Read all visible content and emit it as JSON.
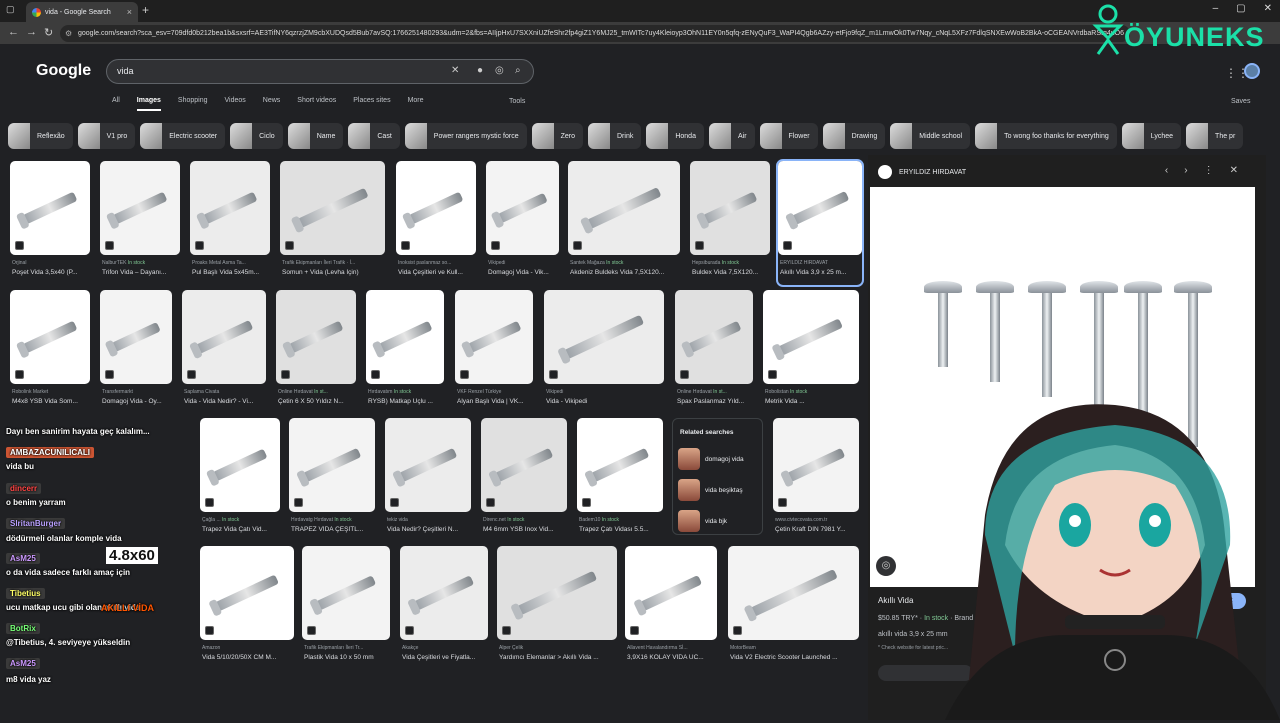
{
  "browser": {
    "tab_title": "vida - Google Search",
    "url": "google.com/search?sca_esv=709dfd0b212bea1b&sxsrf=AE3TifNY6qzrzjZM9cbXUDQsd5Bub7avSQ:1766251480293&udm=2&fbs=AIIjpHxU7SXXniUZfeShr2fp4giZ1Y6MJ25_tmWITc7uy4Kleioyp3OhN11EY0n5qfq-zENyQuF3_WaPI4Qgb6AZzy-etFjo9fqZ_m1LmwOk0Tw7Nqy_cNqL5XFz7FdlqSNXEwWoB2BkA-oCGEANVrdbaRStq4uO6"
  },
  "google": {
    "logo": "Google",
    "query": "vida",
    "filters": [
      "All",
      "Images",
      "Shopping",
      "Videos",
      "News",
      "Short videos",
      "Places sites",
      "More"
    ],
    "active_filter": "Images",
    "tools": "Tools",
    "saves": "Saves"
  },
  "chips": [
    "Reflexão",
    "V1 pro",
    "Electric scooter",
    "Ciclo",
    "Name",
    "Cast",
    "Power rangers mystic force",
    "Zero",
    "Drink",
    "Honda",
    "Air",
    "Flower",
    "Drawing",
    "Middle school",
    "To wong foo thanks for everything",
    "Lychee",
    "The pr"
  ],
  "row1": [
    {
      "src": "Orjinal",
      "stock": "",
      "title": "Poşet Vida 3,5x40 (P..."
    },
    {
      "src": "NalburTEK",
      "stock": "In stock",
      "title": "Trifon Vida – Dayanı..."
    },
    {
      "src": "Proaks Metal Asma Ta...",
      "stock": "",
      "title": "Pul Başlı Vida 5x45m..."
    },
    {
      "src": "Trafik Ekipmanları İleri Trafik · İ...",
      "stock": "",
      "title": "Somun + Vida (Levha İçin)"
    },
    {
      "src": "Inoksist paslanmaz so...",
      "stock": "",
      "title": "Vida Çeşitleri ve Kull..."
    },
    {
      "src": "Vikipedi",
      "stock": "",
      "title": "Domagoj Vida - Vik..."
    },
    {
      "src": "Santek Mağaza",
      "stock": "In stock",
      "title": "Akdeniz Buldeks Vida 7,5X120..."
    },
    {
      "src": "Hepsiburada",
      "stock": "In stock",
      "title": "Buldex Vida 7,5X120..."
    },
    {
      "src": "ERYILDIZ HIRDAVAT",
      "stock": "",
      "title": "Akıllı Vida 3,9 x 25 m..."
    }
  ],
  "row2": [
    {
      "src": "Robolink Market",
      "stock": "",
      "title": "M4x8 YSB Vida Som..."
    },
    {
      "src": "Transfermarkt",
      "stock": "",
      "title": "Domagoj Vida - Oy..."
    },
    {
      "src": "Saplama Civata",
      "stock": "",
      "title": "Vida - Vida Nedir? - Vi..."
    },
    {
      "src": "Online Hırdavat",
      "stock": "In st...",
      "title": "Çetin 6 X 50 Yıldız N..."
    },
    {
      "src": "Hırdavatım",
      "stock": "In stock",
      "title": "RYSB) Matkap Uçlu ..."
    },
    {
      "src": "VKF Renzel Türkiye",
      "stock": "",
      "title": "Alyan Başlı Vida | VK..."
    },
    {
      "src": "Vikipedi",
      "stock": "",
      "title": "Vida - Vikipedi"
    },
    {
      "src": "Online Hırdavat",
      "stock": "In st...",
      "title": "Spax Paslanmaz Yıld..."
    },
    {
      "src": "Robolistan",
      "stock": "In stock",
      "title": "Metrik Vida ..."
    }
  ],
  "row3": [
    {
      "src": "Çağla ...",
      "stock": "In stock",
      "title": "Trapez Vida Çatı Vid..."
    },
    {
      "src": "Hırdavatg Hırdavat",
      "stock": "In stock",
      "title": "TRAPEZ VİDA ÇEŞİTL..."
    },
    {
      "src": "tekiz vida",
      "stock": "",
      "title": "Vida Nedir? Çeşitleri N..."
    },
    {
      "src": "Direnc.net",
      "stock": "In stock",
      "title": "M4 6mm YSB Inox Vid..."
    },
    {
      "src": "Badem10",
      "stock": "In stock",
      "title": "Trapez Çatı Vidası 5.5..."
    },
    {
      "src": "www.civtecovata.com.tr",
      "stock": "",
      "title": "Çetin Kraft DIN 7981 Y..."
    }
  ],
  "row4": [
    {
      "src": "Amazon",
      "stock": "",
      "title": "Vida 5/10/20/50X CM M..."
    },
    {
      "src": "Trafik Ekipmanları İleri Tr...",
      "stock": "",
      "title": "Plastik Vida 10 x 50 mm"
    },
    {
      "src": "Akakçe",
      "stock": "",
      "title": "Vida Çeşitleri ve Fiyatla..."
    },
    {
      "src": "Alper Çelik",
      "stock": "",
      "title": "Yardımcı Elemanlar > Akıllı Vida ..."
    },
    {
      "src": "Allavent Havalandırma Sİ...",
      "stock": "",
      "title": "3,9X16 KOLAY VİDA UC..."
    },
    {
      "src": "MotorBeam",
      "stock": "",
      "title": "Vida V2 Electric Scooter Launched ..."
    }
  ],
  "related": {
    "heading": "Related searches",
    "items": [
      "domagoj vida",
      "vida beşiktaş",
      "vida bjk"
    ]
  },
  "panel": {
    "source": "ERYILDIZ HIRDAVAT",
    "title": "Akıllı Vida",
    "price": "$50.85 TRY*",
    "stock": "In stock",
    "brand": "Brand",
    "name": "akıllı vida 3,9 x 25 mm",
    "note": "* Check website for latest pric...",
    "visit": "Visit"
  },
  "chat": [
    {
      "user": "",
      "text": "Dayı ben sanirim hayata geç kalalım..."
    },
    {
      "user": "AMBAZACUNILICALI",
      "text": "vida bu"
    },
    {
      "user": "dincerr",
      "text": "o benim yarram"
    },
    {
      "user": "SlritanBurger",
      "text": "dödürmeli olanlar komple vida"
    },
    {
      "user": "AsM25",
      "text": "o da vida sadece farklı amaç için"
    },
    {
      "user": "Tibetius",
      "text": "ucu matkap ucu gibi olan akıllı vida"
    },
    {
      "user": "BotRix",
      "text": "@Tibetius, 4. seviyeye yükseldin"
    },
    {
      "user": "AsM25",
      "text": "m8 vida yaz"
    }
  ],
  "overlay_texts": {
    "size_label": "4.8x60",
    "brand_small": "AKILLI VİDA",
    "brand_mark": "ÖYUNEKS"
  },
  "colors": {
    "bg": "#202124",
    "accent": "#8ab4f8",
    "stock": "#81c995",
    "brand": "#1be0a8"
  }
}
